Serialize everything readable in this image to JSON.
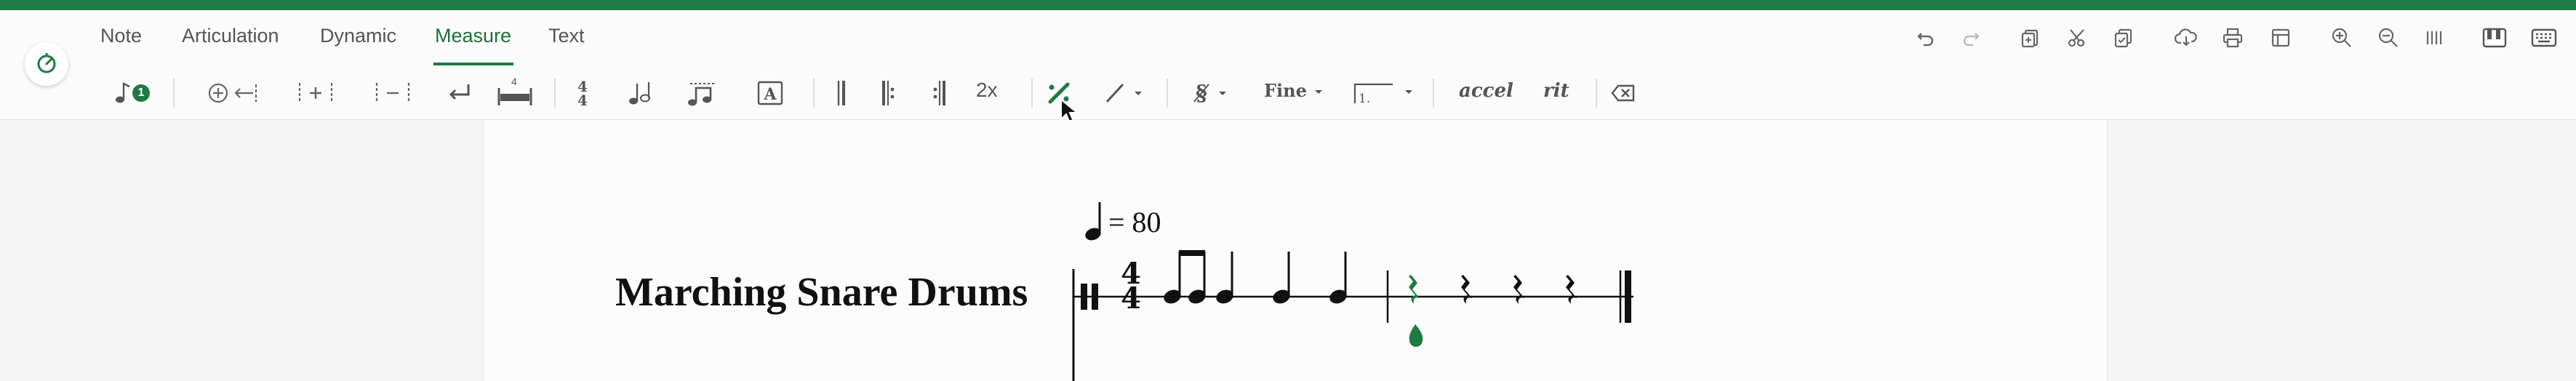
{
  "colors": {
    "accent": "#1f7a43",
    "topbar": "#1e7b43",
    "badge": "#1e7b43",
    "selected_note": "#1f7a43"
  },
  "tabs": [
    {
      "label": "Note"
    },
    {
      "label": "Articulation"
    },
    {
      "label": "Dynamic"
    },
    {
      "label": "Measure",
      "active": true
    },
    {
      "label": "Text"
    }
  ],
  "toolbar": {
    "badge_count": "1",
    "repeat_count_label": "2x",
    "measure_width_number": "4",
    "fine_label": "Fine",
    "ending_label": "1.",
    "accel_label": "accel",
    "rit_label": "rit"
  },
  "icons": {
    "top_right": [
      "undo-icon",
      "redo-icon",
      "add-measure-icon",
      "cut-icon",
      "paste-icon",
      "cloud-download-icon",
      "print-icon",
      "layout-icon",
      "zoom-in-icon",
      "zoom-out-icon",
      "stave-lines-icon",
      "instrument-icon",
      "keyboard-icon"
    ]
  },
  "score": {
    "instrument_name": "Marching Snare Drums",
    "tempo_value": "= 80",
    "time_signature_top": "4",
    "time_signature_bottom": "4"
  }
}
